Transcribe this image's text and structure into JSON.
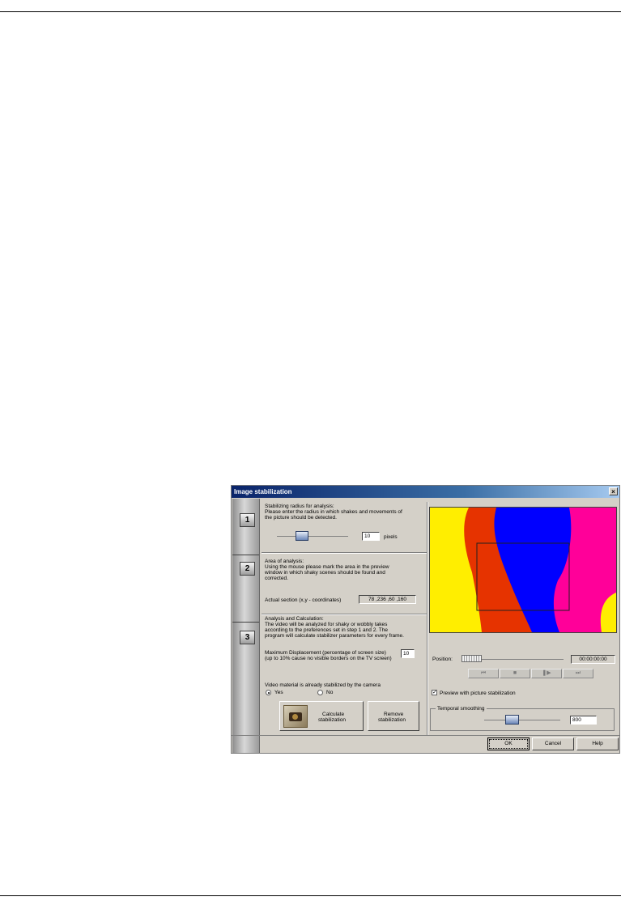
{
  "dialog": {
    "title": "Image stabilization",
    "close_glyph": "×",
    "steps": [
      "1",
      "2",
      "3"
    ]
  },
  "step1": {
    "heading": "Stabilizing radius for analysis:",
    "desc_line1": "Please enter the radius in which shakes and movements of",
    "desc_line2": "the picture should be detected.",
    "radius_value": "10",
    "unit_label": "pixels"
  },
  "step2": {
    "heading": "Area of analysis:",
    "desc_line1": "Using the mouse please mark the area in the preview",
    "desc_line2": "window in which shaky scenes should be found and",
    "desc_line3": "corrected.",
    "section_label": "Actual section (x,y - coordinates)",
    "section_value": "78 ,236 ,60 ,160"
  },
  "step3": {
    "heading": "Analysis and Calculation:",
    "desc_line1": "The video will be analyzed for shaky or wobbly takes",
    "desc_line2": "according to the preferences set in step 1 and 2. The",
    "desc_line3": "program will calculate stabilizer parameters for every frame.",
    "max_disp_line1": "Maximum Displacement (percentage of screen size)",
    "max_disp_line2": "(up to 10% cause no visible borders on the TV screen)",
    "max_disp_value": "10",
    "already_label": "Video material is already stabilized by the camera",
    "yes_label": "Yes",
    "no_label": "No",
    "calc_label_line1": "Calculate",
    "calc_label_line2": "stabilization",
    "remove_label_line1": "Remove",
    "remove_label_line2": "stabilization"
  },
  "preview": {
    "position_label": "Position:",
    "timecode": "00:00:00:00",
    "media_icons": [
      "skip-back-icon",
      "stop-icon",
      "play-step-icon",
      "skip-forward-icon"
    ],
    "preview_check_label": "Preview with picture stabilization",
    "preview_checked": true,
    "smoothing_label": "Temporal smoothing",
    "smoothing_value": "800",
    "colors": {
      "yellow": "#ffee00",
      "red": "#e63300",
      "blue": "#0000ff",
      "magenta": "#ff0099"
    }
  },
  "buttons": {
    "ok": "OK",
    "cancel": "Cancel",
    "help": "Help"
  }
}
